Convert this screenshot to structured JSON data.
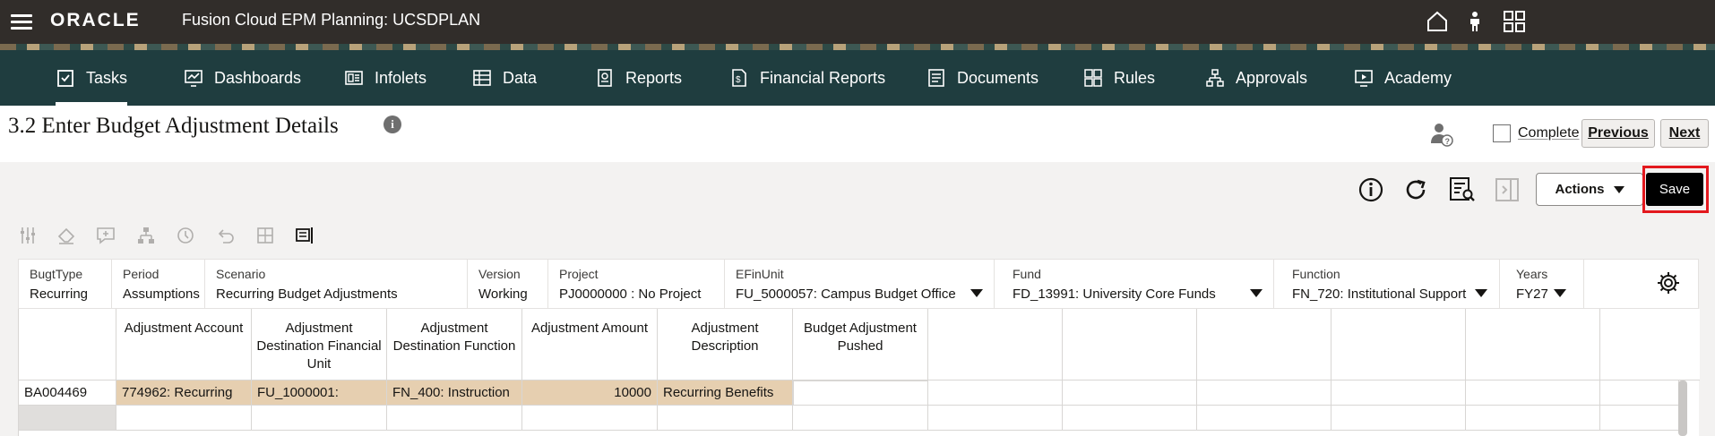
{
  "topbar": {
    "logo": "ORACLE",
    "app_title": "Fusion Cloud EPM Planning:  UCSDPLAN",
    "icons": [
      "home-icon",
      "accessibility-icon",
      "apps-grid-icon"
    ]
  },
  "nav": {
    "items": [
      {
        "label": "Tasks",
        "icon": "tasks-icon",
        "active": true
      },
      {
        "label": "Dashboards",
        "icon": "dashboards-icon"
      },
      {
        "label": "Infolets",
        "icon": "infolets-icon"
      },
      {
        "label": "Data",
        "icon": "data-icon"
      },
      {
        "label": "Reports",
        "icon": "reports-icon"
      },
      {
        "label": "Financial Reports",
        "icon": "financial-reports-icon"
      },
      {
        "label": "Documents",
        "icon": "documents-icon"
      },
      {
        "label": "Rules",
        "icon": "rules-icon"
      },
      {
        "label": "Approvals",
        "icon": "approvals-icon"
      },
      {
        "label": "Academy",
        "icon": "academy-icon"
      }
    ]
  },
  "task": {
    "title": "3.2 Enter Budget Adjustment Details",
    "complete_label": "Complete",
    "complete_checked": false,
    "previous_label": "Previous",
    "next_label": "Next"
  },
  "toolbar": {
    "actions_label": "Actions",
    "save_label": "Save"
  },
  "pov": [
    {
      "label": "BugtType",
      "value": "Recurring"
    },
    {
      "label": "Period",
      "value": "Assumptions"
    },
    {
      "label": "Scenario",
      "value": "Recurring Budget Adjustments"
    },
    {
      "label": "Version",
      "value": "Working"
    },
    {
      "label": "Project",
      "value": "PJ0000000 : No Project"
    },
    {
      "label": "EFinUnit",
      "value": "FU_5000057: Campus Budget Office"
    },
    {
      "label": "Fund",
      "value": "FD_13991: University Core Funds"
    },
    {
      "label": "Function",
      "value": "FN_720: Institutional Support"
    },
    {
      "label": "Years",
      "value": "FY27"
    }
  ],
  "grid": {
    "columns": [
      "Adjustment Account",
      "Adjustment Destination Financial Unit",
      "Adjustment Destination Function",
      "Adjustment Amount",
      "Adjustment Description",
      "Budget Adjustment Pushed"
    ],
    "rows": [
      {
        "header": "BA004469",
        "cells": [
          "774962: Recurring",
          "FU_1000001:",
          "FN_400: Instruction",
          "10000",
          "Recurring Benefits",
          ""
        ]
      }
    ]
  },
  "colors": {
    "topbar": "#312d2a",
    "navbar": "#1f3d3f",
    "highlight_cell": "#e6cfb0",
    "save_highlight_frame": "#e3191e"
  }
}
